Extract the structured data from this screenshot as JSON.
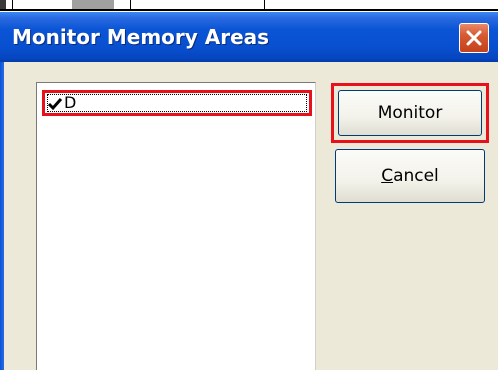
{
  "dialog": {
    "title": "Monitor Memory Areas"
  },
  "list": {
    "items": [
      {
        "label": "D",
        "checked": true
      }
    ]
  },
  "buttons": {
    "monitor_label": "Monitor",
    "cancel_label_mnemonic": "C",
    "cancel_label_rest": "ancel"
  },
  "icons": {
    "close": "close-icon",
    "check": "checkmark-icon"
  },
  "colors": {
    "titlebar": "#0a54d6",
    "highlight": "#e8111b",
    "dialog_bg": "#ece9d8",
    "close_button": "#d65a32"
  }
}
